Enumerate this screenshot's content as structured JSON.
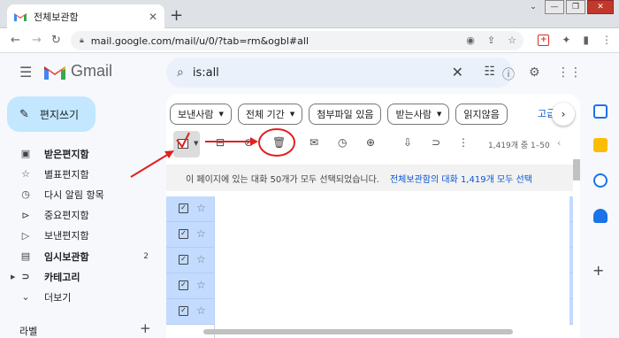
{
  "browser": {
    "tab_title": "전체보관함",
    "url": "mail.google.com/mail/u/0/?tab=rm&ogbl#all"
  },
  "gmail": {
    "logo_text": "Gmail",
    "search_value": "is:all"
  },
  "sidebar": {
    "compose_label": "편지쓰기",
    "items": [
      {
        "label": "받은편지함",
        "icon": "inbox-icon",
        "bold": true
      },
      {
        "label": "별표편지함",
        "icon": "star-icon",
        "bold": false
      },
      {
        "label": "다시 알림 항목",
        "icon": "clock-icon",
        "bold": false
      },
      {
        "label": "중요편지함",
        "icon": "important-icon",
        "bold": false
      },
      {
        "label": "보낸편지함",
        "icon": "send-icon",
        "bold": false
      },
      {
        "label": "임시보관함",
        "icon": "draft-icon",
        "bold": true,
        "count": "2"
      },
      {
        "label": "카테고리",
        "icon": "label-icon",
        "bold": true
      },
      {
        "label": "더보기",
        "icon": "chevron-down-icon",
        "bold": false
      }
    ],
    "labels_title": "라벨"
  },
  "filters": {
    "chips": [
      "보낸사람",
      "전체 기간",
      "첨부파일 있음",
      "받는사람",
      "읽지않음"
    ],
    "more": "고급"
  },
  "toolbar": {
    "count_text": "1,419개 중 1–50"
  },
  "banner": {
    "text": "이 페이지에 있는 대화 50개가 모두 선택되었습니다.",
    "link": "전체보관함의 대화 1,419개 모두 선택"
  },
  "colors": {
    "accent": "#0b57d0",
    "compose": "#c2e7ff",
    "selected_row": "#c2dbff",
    "annotation_red": "#e02020"
  }
}
